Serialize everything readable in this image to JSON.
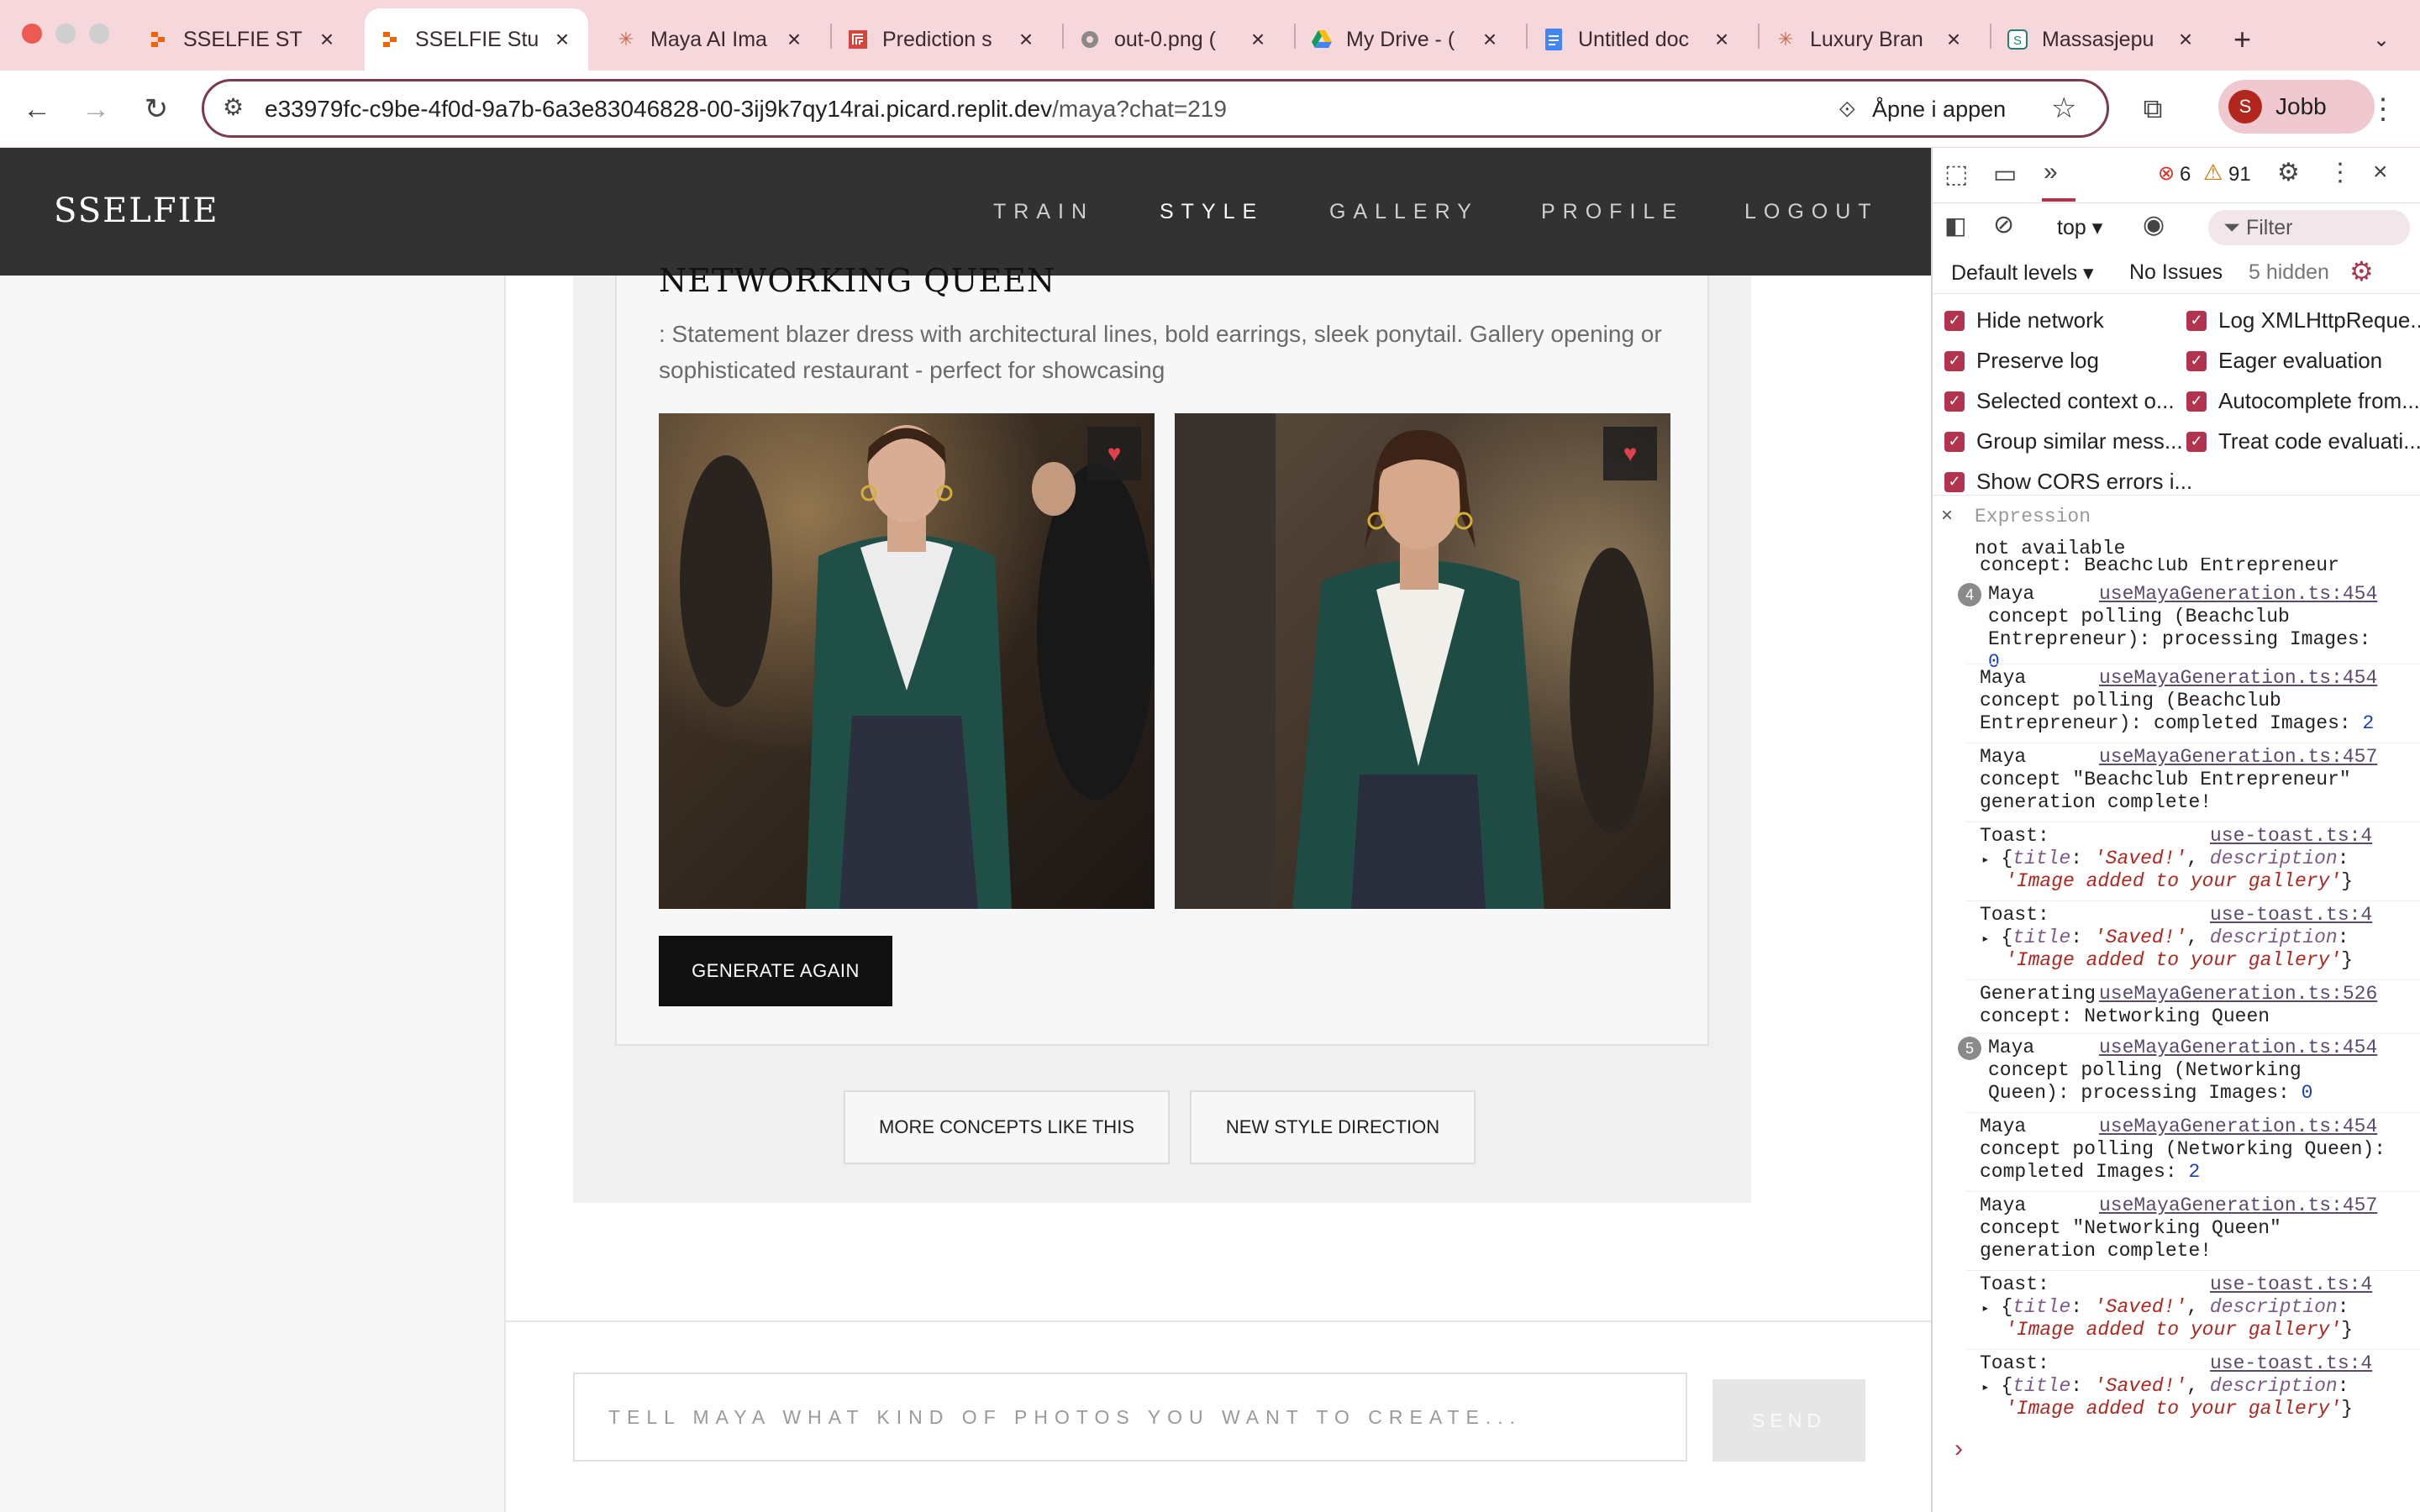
{
  "browser": {
    "tabs": [
      {
        "title": "SSELFIE ST",
        "icon": "replit-icon"
      },
      {
        "title": "SSELFIE Stu",
        "icon": "replit-icon",
        "active": true
      },
      {
        "title": "Maya AI Ima",
        "icon": "claude-icon"
      },
      {
        "title": "Prediction s",
        "icon": "replicate-icon"
      },
      {
        "title": "out-0.png (",
        "icon": "globe-icon"
      },
      {
        "title": "My Drive - (",
        "icon": "drive-icon"
      },
      {
        "title": "Untitled doc",
        "icon": "docs-icon"
      },
      {
        "title": "Luxury Bran",
        "icon": "claude-icon"
      },
      {
        "title": "Massasjepu",
        "icon": "site-icon"
      }
    ],
    "new_tab_label": "+",
    "url_host": "e33979fc-c9be-4f0d-9a7b-6a3e83046828-00-3ij9k7qy14rai.picard.replit.dev",
    "url_path": "/maya?chat=219",
    "open_in_app": "Åpne i appen",
    "profile_initial": "S",
    "profile_name": "Jobb"
  },
  "site": {
    "logo": "SSELFIE",
    "nav": [
      "TRAIN",
      "STYLE",
      "GALLERY",
      "PROFILE",
      "LOGOUT"
    ],
    "active_nav": "STYLE"
  },
  "concept": {
    "title": "NETWORKING QUEEN",
    "description": ": Statement blazer dress with architectural lines, bold earrings, sleek ponytail. Gallery opening or sophisticated restaurant - perfect for showcasing",
    "images": [
      {
        "alt": "Woman in green blazer at networking event",
        "favorited": true
      },
      {
        "alt": "Woman in green blazer leaning on bar",
        "favorited": true
      }
    ],
    "generate_again": "GENERATE AGAIN",
    "more_concepts": "MORE CONCEPTS LIKE THIS",
    "new_direction": "NEW STYLE DIRECTION"
  },
  "chat": {
    "placeholder": "TELL MAYA WHAT KIND OF PHOTOS YOU WANT TO CREATE...",
    "send": "SEND"
  },
  "devtools": {
    "errors": "6",
    "warnings": "91",
    "context": "top",
    "filter_placeholder": "Filter",
    "levels": "Default levels",
    "issues": "No Issues",
    "hidden": "5 hidden",
    "settings_left": [
      "Hide network",
      "Preserve log",
      "Selected context o...",
      "Group similar mess...",
      "Show CORS errors i..."
    ],
    "settings_right": [
      "Log XMLHttpReque...",
      "Eager evaluation",
      "Autocomplete from...",
      "Treat code evaluati..."
    ],
    "expression_label": "Expression",
    "expression_value": "not available",
    "cut_line": "concept: Beachclub Entrepreneur",
    "logs": [
      {
        "count": "4",
        "src": "useMayaGeneration.ts:454",
        "lines": [
          "Maya",
          "concept polling (Beachclub",
          "Entrepreneur): processing Images:"
        ],
        "num": "0"
      },
      {
        "src": "useMayaGeneration.ts:454",
        "lines": [
          "Maya",
          "concept polling (Beachclub",
          "Entrepreneur): completed Images:"
        ],
        "num": "2"
      },
      {
        "src": "useMayaGeneration.ts:457",
        "lines": [
          "Maya",
          "concept \"Beachclub Entrepreneur\"",
          "generation complete!"
        ]
      },
      {
        "src": "use-toast.ts:4",
        "toast": true
      },
      {
        "src": "use-toast.ts:4",
        "toast": true
      },
      {
        "src": "useMayaGeneration.ts:526",
        "lines": [
          "Generating",
          "concept: Networking Queen"
        ]
      },
      {
        "count": "5",
        "src": "useMayaGeneration.ts:454",
        "lines": [
          "Maya",
          "concept polling (Networking",
          "Queen): processing Images:"
        ],
        "num": "0"
      },
      {
        "src": "useMayaGeneration.ts:454",
        "lines": [
          "Maya",
          "concept polling (Networking Queen):",
          "completed Images:"
        ],
        "num": "2"
      },
      {
        "src": "useMayaGeneration.ts:457",
        "lines": [
          "Maya",
          "concept \"Networking Queen\"",
          "generation complete!"
        ]
      },
      {
        "src": "use-toast.ts:4",
        "toast": true
      },
      {
        "src": "use-toast.ts:4",
        "toast": true
      }
    ],
    "toast_label": "Toast:",
    "toast_title_key": "title",
    "toast_title_val": "'Saved!'",
    "toast_desc_key": "description",
    "toast_desc_val": "'Image added to your gallery'",
    "prompt_symbol": "›"
  }
}
